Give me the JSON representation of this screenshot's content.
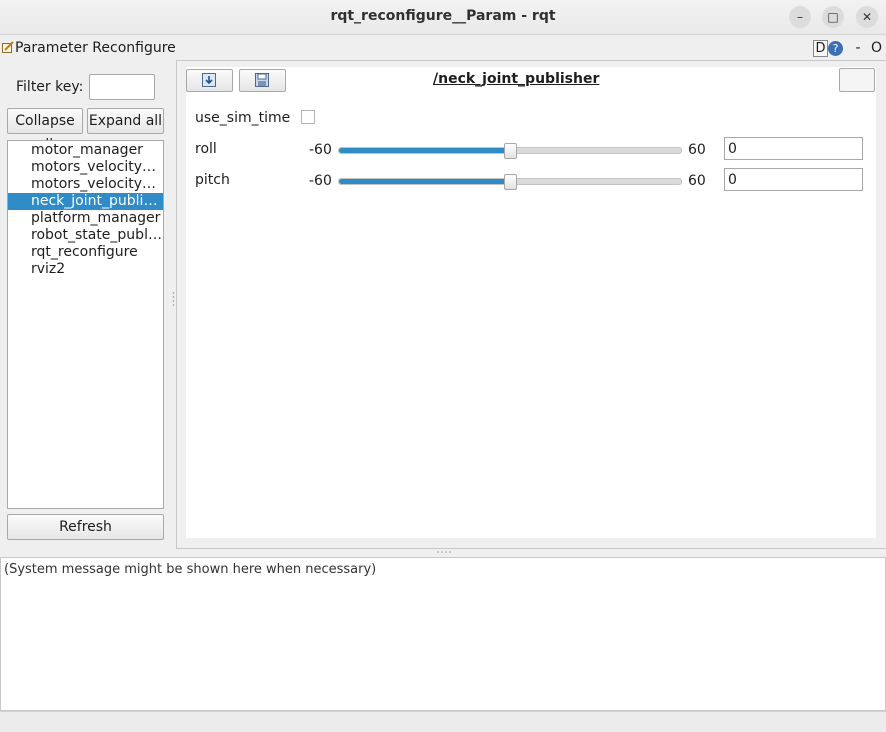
{
  "window": {
    "title": "rqt_reconfigure__Param - rqt",
    "minimize_glyph": "–",
    "maximize_glyph": "□",
    "close_glyph": "✕"
  },
  "plugin": {
    "title": "Parameter Reconfigure",
    "dock_d": "D",
    "dock_help": "?",
    "dock_minus": "-",
    "dock_o": "O"
  },
  "left": {
    "filter_label": "Filter key:",
    "filter_value": "",
    "collapse_label": "Collapse all",
    "expand_label": "Expand all",
    "refresh_label": "Refresh",
    "nodes": [
      {
        "label": "motor_manager"
      },
      {
        "label": "motors_velocity_controller"
      },
      {
        "label": "motors_velocity_publisher"
      },
      {
        "label": "neck_joint_publisher",
        "selected": true
      },
      {
        "label": "platform_manager"
      },
      {
        "label": "robot_state_publisher"
      },
      {
        "label": "rqt_reconfigure"
      },
      {
        "label": "rviz2"
      }
    ]
  },
  "editor": {
    "node_title": "/neck_joint_publisher",
    "params": {
      "use_sim_time": {
        "label": "use_sim_time",
        "checked": false
      },
      "roll": {
        "label": "roll",
        "min": "-60",
        "max": "60",
        "value": "0",
        "level": 0.5
      },
      "pitch": {
        "label": "pitch",
        "min": "-60",
        "max": "60",
        "value": "0",
        "level": 0.5
      }
    }
  },
  "console": {
    "message": "(System message might be shown here when necessary)"
  },
  "colors": {
    "accent": "#308cc6"
  }
}
